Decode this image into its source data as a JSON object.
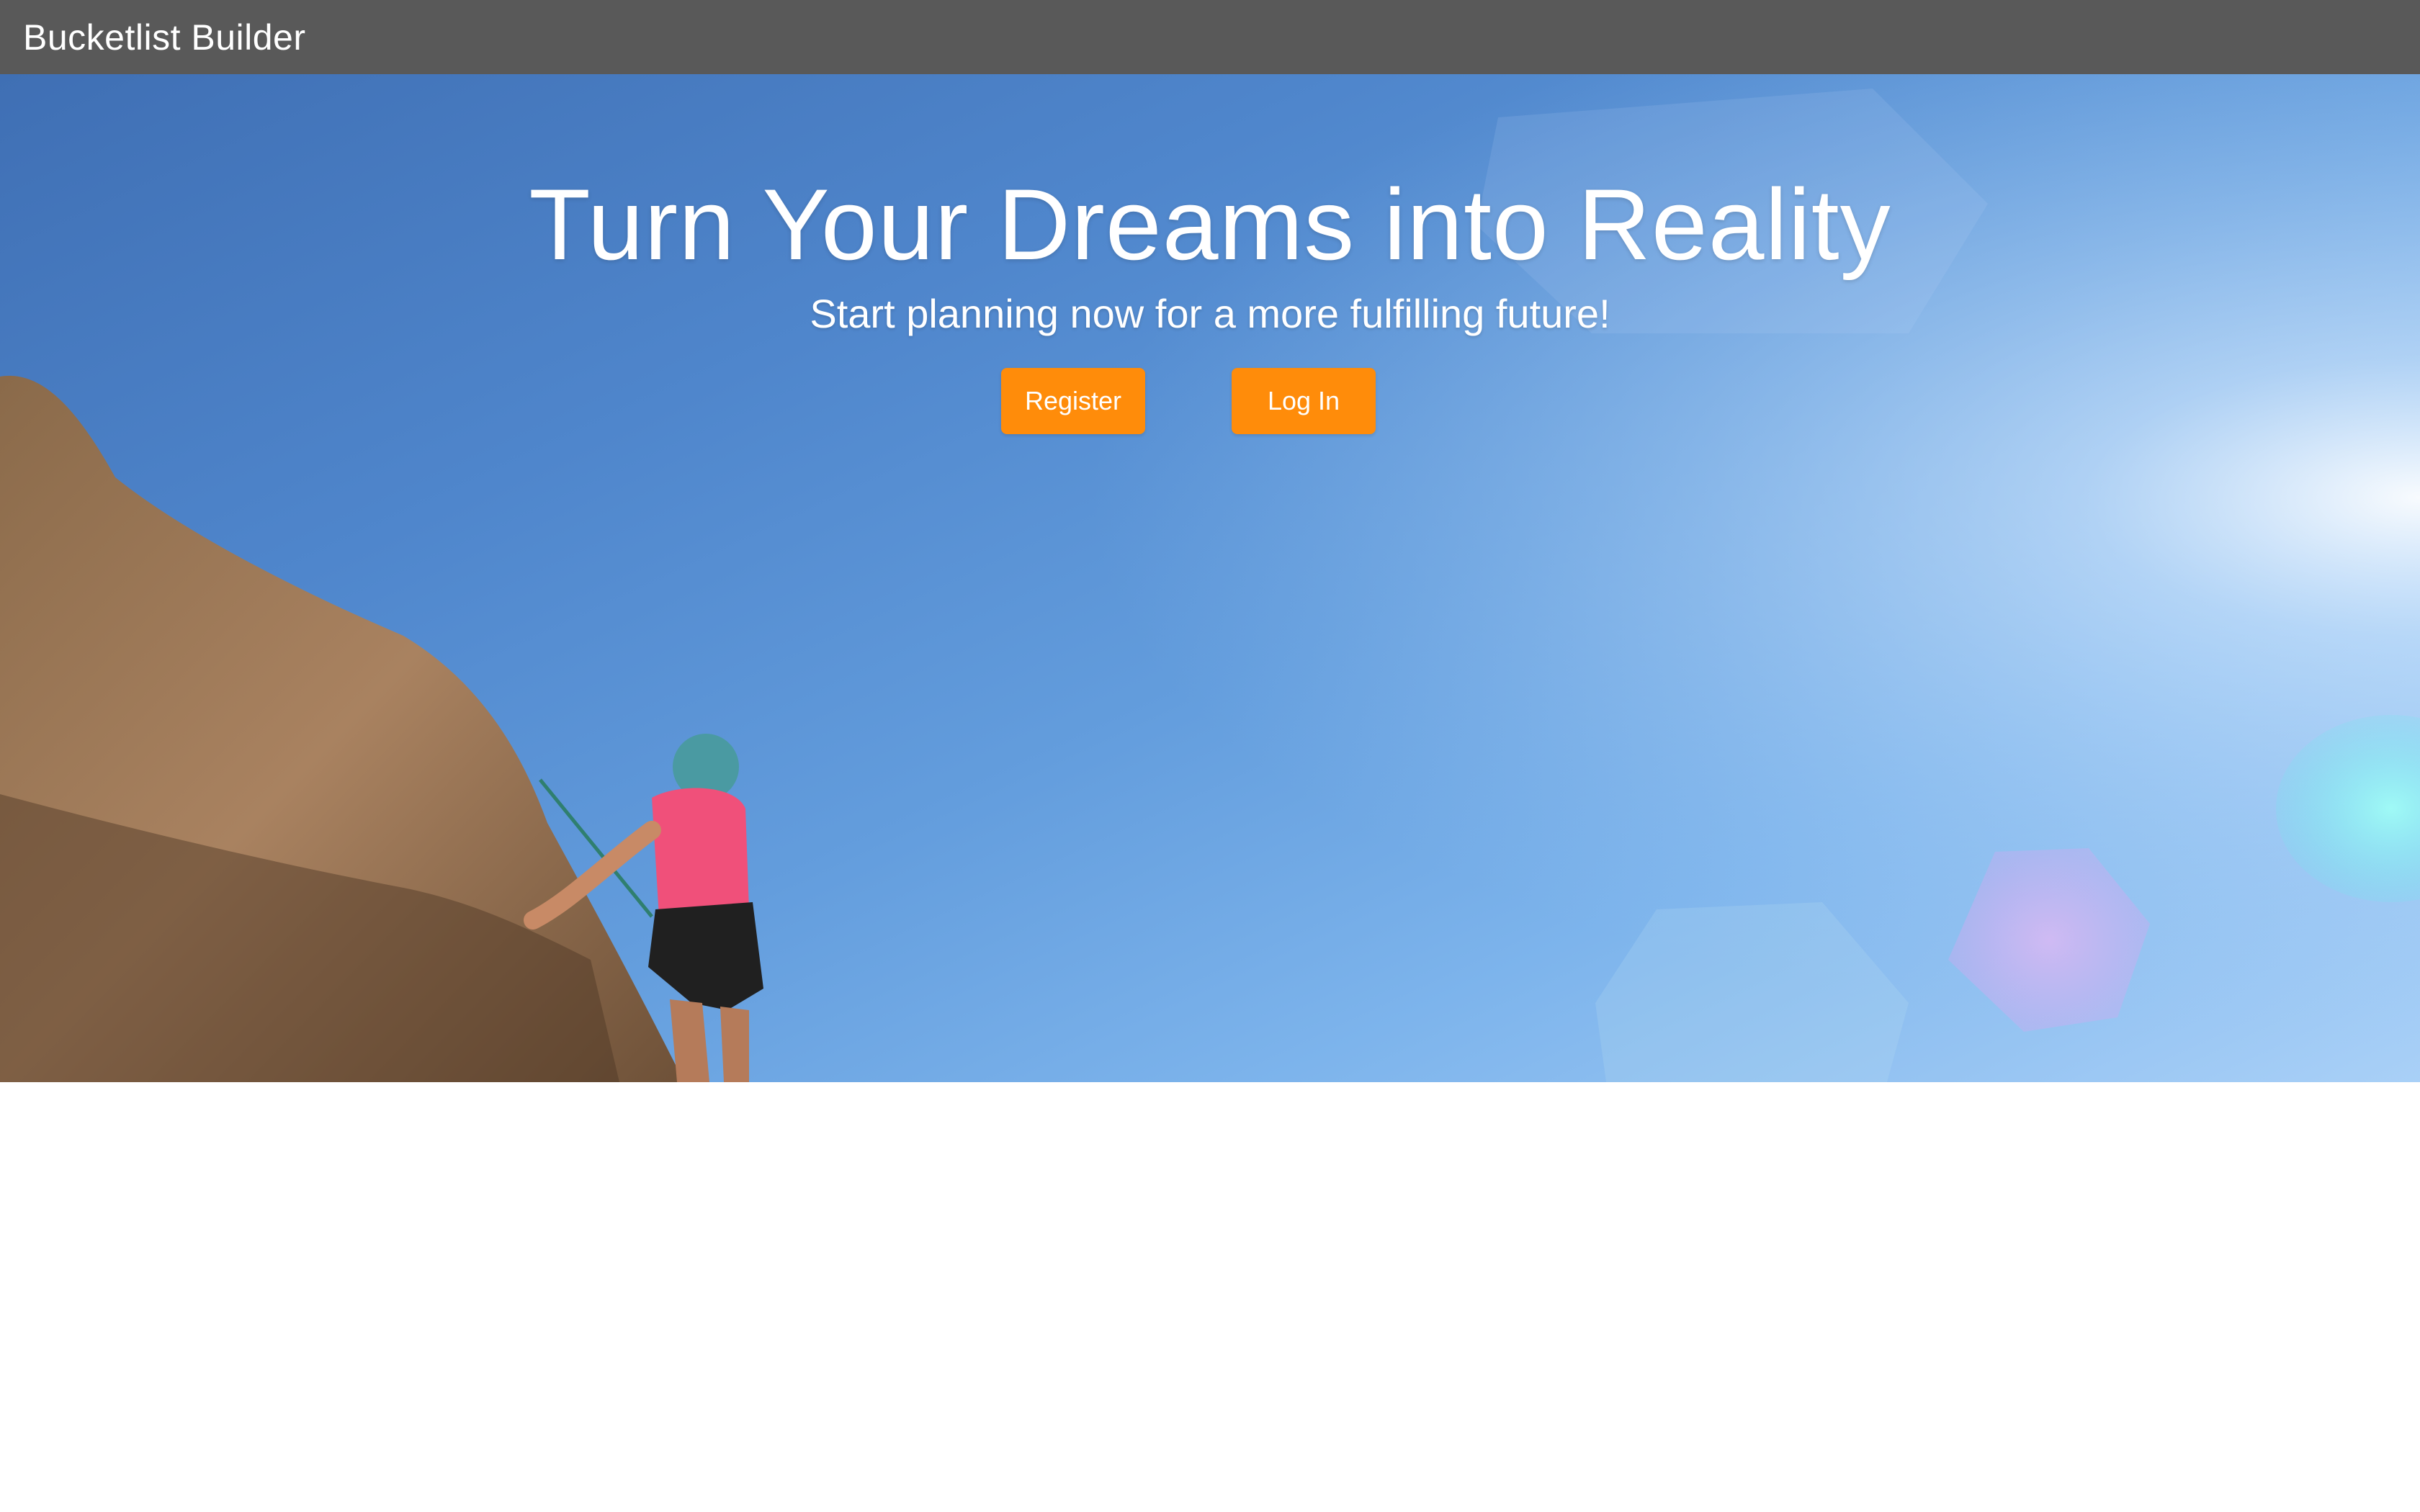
{
  "navbar": {
    "brand": "Bucketlist Builder"
  },
  "hero": {
    "headline": "Turn Your Dreams into Reality",
    "subheadline": "Start planning now for a more fulfilling future!",
    "buttons": {
      "register": "Register",
      "login": "Log In"
    },
    "background_image": "rock-climber-on-cliff-against-blue-sky"
  },
  "colors": {
    "navbar": "#595959",
    "accent": "#ff8c0a",
    "sky": "#4f86cc",
    "text": "#ffffff"
  }
}
